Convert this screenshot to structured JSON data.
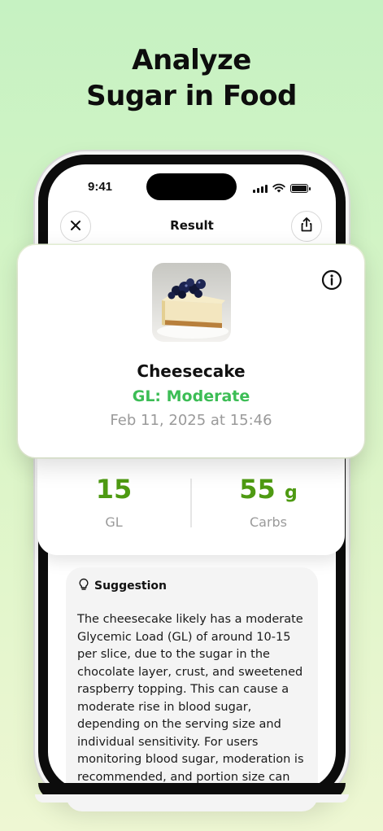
{
  "headline": {
    "line1": "Analyze",
    "line2": "Sugar in Food"
  },
  "status_bar": {
    "time": "9:41"
  },
  "nav": {
    "title": "Result",
    "close_icon": "close-icon",
    "share_icon": "share-icon"
  },
  "food": {
    "name": "Cheesecake",
    "gl_level": "GL: Moderate",
    "timestamp": "Feb 11, 2025 at 15:46",
    "image_alt": "cheesecake-with-blueberries"
  },
  "stats": {
    "gl_value": "15",
    "gl_label": "GL",
    "carbs_value": "55",
    "carbs_unit": "g",
    "carbs_label": "Carbs"
  },
  "suggestion": {
    "title": "Suggestion",
    "icon": "lightbulb-icon",
    "text": "The cheesecake likely has a moderate Glycemic Load (GL) of around 10-15 per slice, due to the sugar in the chocolate layer, crust, and sweetened raspberry topping. This can cause a moderate rise in blood sugar, depending on the serving size and individual sensitivity. For users monitoring blood sugar, moderation is recommended, and portion size can"
  },
  "colors": {
    "accent_green": "#3cbd55",
    "stat_green": "#4e9a12",
    "muted_gray": "#9a9a9a",
    "background_top": "#c6f2c2",
    "background_bottom": "#eef7d3"
  }
}
